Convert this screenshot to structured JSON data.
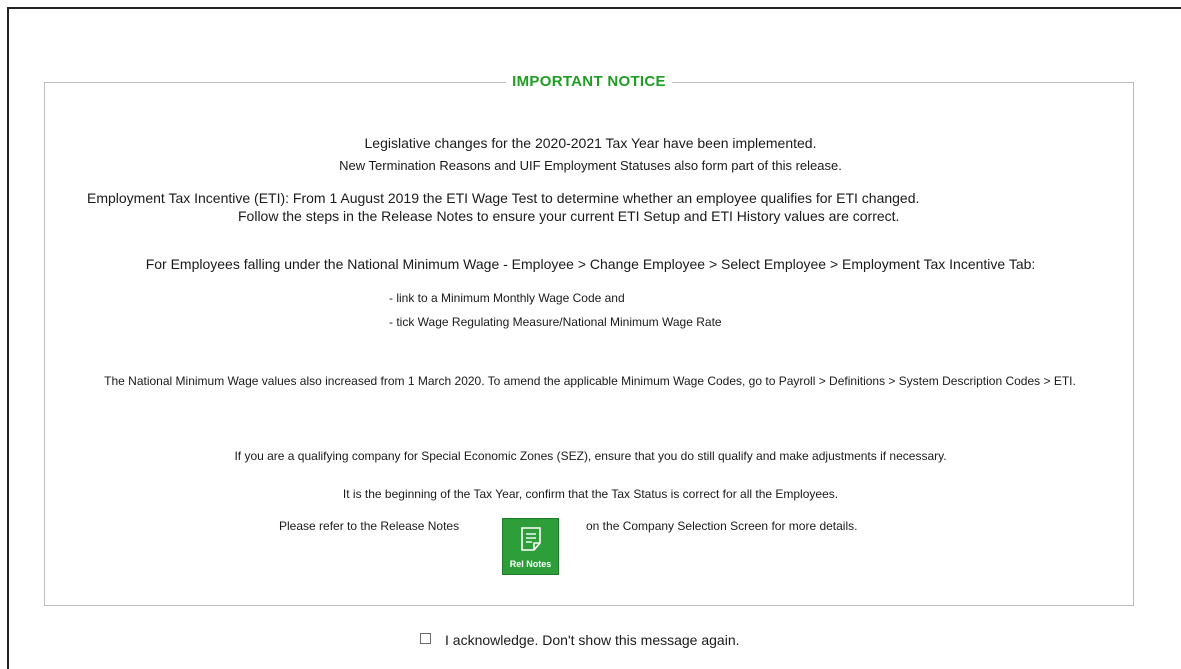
{
  "notice": {
    "title": "IMPORTANT NOTICE",
    "lines": {
      "legislative": "Legislative changes for the 2020-2021 Tax Year have been implemented.",
      "termination": "New Termination Reasons and UIF Employment Statuses also form part of this release.",
      "eti_change": "Employment Tax Incentive (ETI): From 1 August 2019 the ETI Wage Test to determine whether an employee qualifies for ETI changed.",
      "eti_steps": "Follow the steps in the Release Notes to ensure your current ETI Setup and ETI History values are correct.",
      "nmw_employees": "For Employees falling under the National Minimum Wage - Employee > Change Employee > Select Employee > Employment Tax Incentive Tab:",
      "bullet_1": "- link to a Minimum Monthly Wage Code and",
      "bullet_2": "- tick Wage Regulating Measure/National Minimum Wage Rate",
      "nmw_values": "The National Minimum Wage values also increased from 1 March 2020. To amend the applicable Minimum Wage Codes, go to Payroll > Definitions > System Description Codes > ETI.",
      "sez": "If you are a qualifying company for Special Economic Zones (SEZ), ensure that you do still qualify and make adjustments if necessary.",
      "tax_status": "It is the beginning of the Tax Year, confirm that the Tax Status is correct for all the Employees.",
      "refer_prefix": "Please refer to the Release Notes",
      "refer_suffix": "on the Company Selection Screen for more details."
    },
    "rel_notes_button": {
      "label": "Rel Notes",
      "icon": "document-icon",
      "color": "#2e9e3a"
    },
    "title_color": "#1e9e22"
  },
  "acknowledge": {
    "label": "I acknowledge. Don't show this message again.",
    "checked": false
  }
}
